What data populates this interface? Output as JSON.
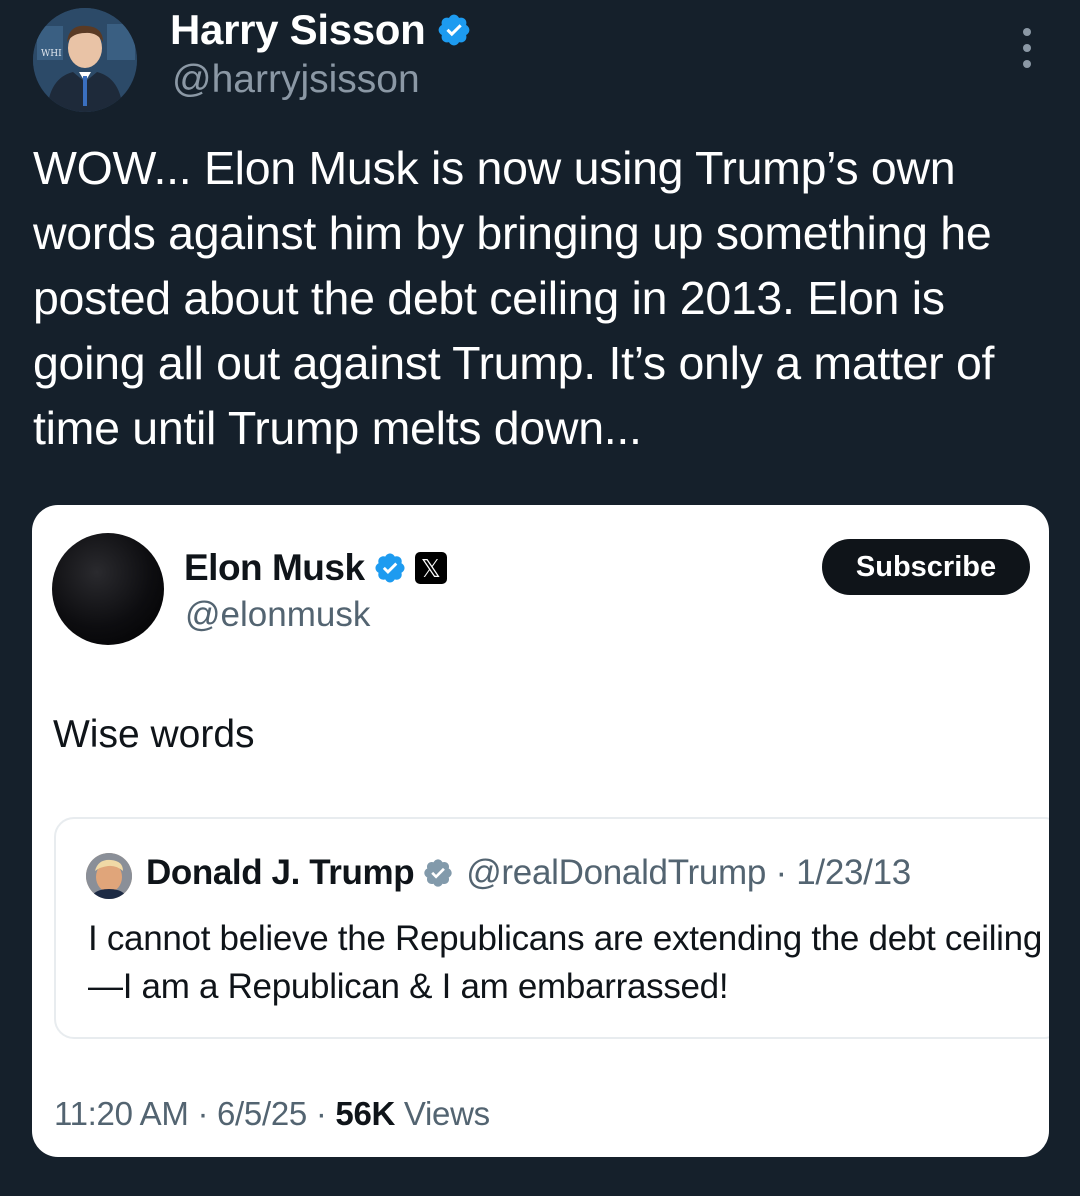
{
  "tweet": {
    "author_name": "Harry Sisson",
    "author_handle": "@harryjsisson",
    "text": "WOW... Elon Musk is now using Trump’s own words against him by bringing up something he posted about the debt ceiling in 2013. Elon is going all out against Trump. It’s only a matter of time until Trump melts down...",
    "avatar_sign_text": "WHI"
  },
  "embedded": {
    "author_name": "Elon Musk",
    "author_handle": "@elonmusk",
    "x_badge": "𝕏",
    "subscribe_label": "Subscribe",
    "text": "Wise words",
    "quote": {
      "author_name": "Donald J. Trump",
      "handle_date": "@realDonaldTrump · 1/23/13",
      "text": "I cannot believe the Republicans are extending the debt ceiling—I am a Republican & I am embarrassed!"
    },
    "footer": {
      "time_date": "11:20 AM · 6/5/25 · ",
      "views_count": "56K",
      "views_label": " Views"
    }
  },
  "colors": {
    "background": "#15202b",
    "verified_blue": "#1d9bf0",
    "verified_gray": "#829aab"
  },
  "icons": [
    "verified-badge-icon",
    "more-options-icon",
    "x-logo-icon"
  ]
}
